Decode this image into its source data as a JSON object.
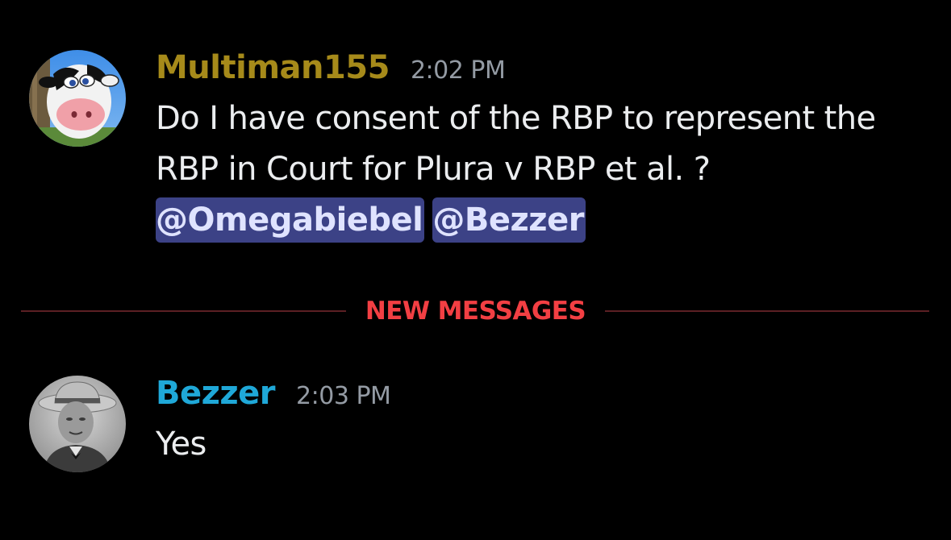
{
  "messages": [
    {
      "author": "Multiman155",
      "author_color": "#a68a1a",
      "timestamp": "2:02 PM",
      "lines": [
        "Do I have consent of the RBP to represent the",
        "RBP in Court for Plura v RBP et al. ?"
      ],
      "mentions": [
        "@Omegabiebel",
        "@Bezzer"
      ],
      "avatar": "cow-avatar"
    },
    {
      "author": "Bezzer",
      "author_color": "#1fa8d8",
      "timestamp": "2:03 PM",
      "lines": [
        "Yes"
      ],
      "avatar": "portrait-avatar"
    }
  ],
  "divider": {
    "label": "NEW MESSAGES",
    "color": "#f23f43"
  },
  "colors": {
    "background": "#000000",
    "mention_bg": "#3c4286",
    "timestamp": "#949ba4"
  }
}
